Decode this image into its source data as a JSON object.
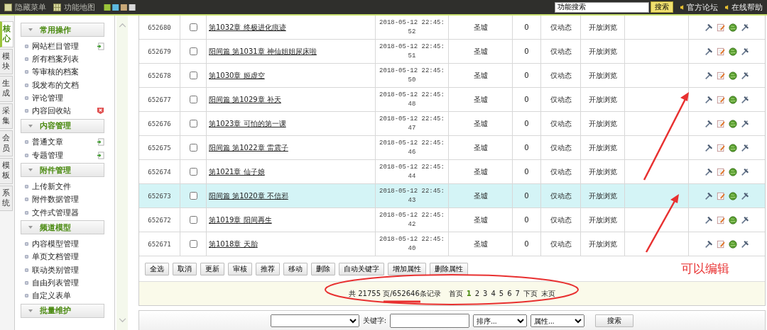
{
  "top_bar": {
    "links": [
      "隐藏菜单",
      "功能地图"
    ],
    "search": {
      "value": "功能搜索",
      "button": "搜索"
    },
    "help_links": [
      "官方论坛",
      "在线帮助"
    ]
  },
  "side_tabs": [
    {
      "label": "核心",
      "selected": true
    },
    {
      "label": "模块",
      "selected": false
    },
    {
      "label": "生成",
      "selected": false
    },
    {
      "label": "采集",
      "selected": false
    },
    {
      "label": "会员",
      "selected": false
    },
    {
      "label": "模板",
      "selected": false
    },
    {
      "label": "系统",
      "selected": false
    }
  ],
  "menu_groups": [
    {
      "title": "常用操作",
      "items": [
        {
          "label": "网站栏目管理",
          "kind": "add"
        },
        {
          "label": "所有档案列表",
          "kind": "plain"
        },
        {
          "label": "等审核的档案",
          "kind": "plain"
        },
        {
          "label": "我发布的文档",
          "kind": "plain"
        },
        {
          "label": "评论管理",
          "kind": "plain"
        },
        {
          "label": "内容回收站",
          "kind": "delete"
        }
      ]
    },
    {
      "title": "内容管理",
      "items": [
        {
          "label": "普通文章",
          "kind": "add"
        },
        {
          "label": "专题管理",
          "kind": "add"
        }
      ]
    },
    {
      "title": "附件管理",
      "items": [
        {
          "label": "上传新文件",
          "kind": "plain"
        },
        {
          "label": "附件数据管理",
          "kind": "plain"
        },
        {
          "label": "文件式管理器",
          "kind": "plain"
        }
      ]
    },
    {
      "title": "频道模型",
      "items": [
        {
          "label": "内容模型管理",
          "kind": "plain"
        },
        {
          "label": "单页文档管理",
          "kind": "plain"
        },
        {
          "label": "联动类别管理",
          "kind": "plain"
        },
        {
          "label": "自由列表管理",
          "kind": "plain"
        },
        {
          "label": "自定义表单",
          "kind": "plain"
        }
      ]
    },
    {
      "title": "批量维护"
    }
  ],
  "rows": [
    {
      "id": "652680",
      "title": "第1032章 终极进化痕迹",
      "date": "2018-05-12 22:45:52",
      "category": "圣墟",
      "clicks": "0",
      "publish": "仅动态",
      "access": "开放浏览",
      "selected": false,
      "checked": false
    },
    {
      "id": "652679",
      "title": "阳间篇 第1031章 神仙姐姐尿床啦",
      "date": "2018-05-12 22:45:51",
      "category": "圣墟",
      "clicks": "0",
      "publish": "仅动态",
      "access": "开放浏览",
      "selected": false,
      "checked": false
    },
    {
      "id": "652678",
      "title": "第1030章 姬虚空",
      "date": "2018-05-12 22:45:50",
      "category": "圣墟",
      "clicks": "0",
      "publish": "仅动态",
      "access": "开放浏览",
      "selected": false,
      "checked": false
    },
    {
      "id": "652677",
      "title": "阳间篇 第1029章 补天",
      "date": "2018-05-12 22:45:48",
      "category": "圣墟",
      "clicks": "0",
      "publish": "仅动态",
      "access": "开放浏览",
      "selected": false,
      "checked": false
    },
    {
      "id": "652676",
      "title": "第1023章 可怕的第一课",
      "date": "2018-05-12 22:45:47",
      "category": "圣墟",
      "clicks": "0",
      "publish": "仅动态",
      "access": "开放浏览",
      "selected": false,
      "checked": false
    },
    {
      "id": "652675",
      "title": "阳间篇 第1022章 雷震子",
      "date": "2018-05-12 22:45:46",
      "category": "圣墟",
      "clicks": "0",
      "publish": "仅动态",
      "access": "开放浏览",
      "selected": false,
      "checked": false
    },
    {
      "id": "652674",
      "title": "第1021章 仙子娘",
      "date": "2018-05-12 22:45:44",
      "category": "圣墟",
      "clicks": "0",
      "publish": "仅动态",
      "access": "开放浏览",
      "selected": false,
      "checked": false
    },
    {
      "id": "652673",
      "title": "阳间篇 第1020章 不信邪",
      "date": "2018-05-12 22:45:43",
      "category": "圣墟",
      "clicks": "0",
      "publish": "仅动态",
      "access": "开放浏览",
      "selected": true,
      "checked": false
    },
    {
      "id": "652672",
      "title": "第1019章 阳间再生",
      "date": "2018-05-12 22:45:42",
      "category": "圣墟",
      "clicks": "0",
      "publish": "仅动态",
      "access": "开放浏览",
      "selected": false,
      "checked": false
    },
    {
      "id": "652671",
      "title": "第1018章 天胎",
      "date": "2018-05-12 22:45:40",
      "category": "圣墟",
      "clicks": "0",
      "publish": "仅动态",
      "access": "开放浏览",
      "selected": false,
      "checked": false
    }
  ],
  "action_buttons": [
    "全选",
    "取消",
    "更新",
    "审核",
    "推荐",
    "移动",
    "删除",
    "自动关键字",
    "增加属性",
    "删除属性"
  ],
  "annotation": "可以编辑",
  "pager": {
    "total": "共 21755 页/652646条记录",
    "links": [
      {
        "label": "首页",
        "selected": false
      },
      {
        "label": "1",
        "selected": true
      },
      {
        "label": "2",
        "selected": false
      },
      {
        "label": "3",
        "selected": false
      },
      {
        "label": "4",
        "selected": false
      },
      {
        "label": "5",
        "selected": false
      },
      {
        "label": "6",
        "selected": false
      },
      {
        "label": "7",
        "selected": false
      },
      {
        "label": "下页",
        "selected": false
      },
      {
        "label": "末页",
        "selected": false
      }
    ]
  },
  "filter": {
    "keyword_label": "关键字:",
    "sort_select": "排序...",
    "attr_select": "属性...",
    "button": "搜索"
  }
}
